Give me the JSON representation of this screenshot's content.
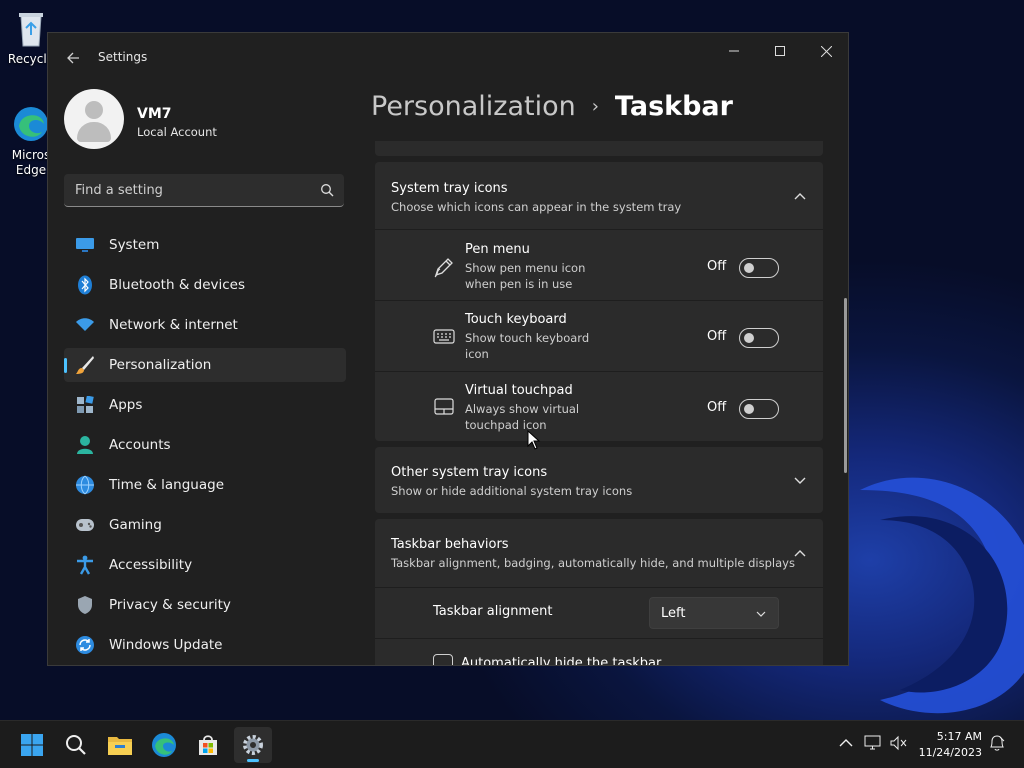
{
  "desktop": {
    "icons": [
      {
        "label": "Recycle",
        "icon": "recycle-bin-icon"
      },
      {
        "label": "Micros Edge",
        "icon": "edge-icon"
      }
    ]
  },
  "window": {
    "title": "Settings",
    "back_icon": "back-arrow-icon",
    "controls": {
      "minimize": "—",
      "maximize": "☐",
      "close": "✕"
    }
  },
  "user": {
    "name": "VM7",
    "account_type": "Local Account"
  },
  "search": {
    "placeholder": "Find a setting",
    "icon": "search-icon"
  },
  "nav": {
    "items": [
      {
        "label": "System",
        "icon": "monitor-icon"
      },
      {
        "label": "Bluetooth & devices",
        "icon": "bluetooth-icon"
      },
      {
        "label": "Network & internet",
        "icon": "wifi-icon"
      },
      {
        "label": "Personalization",
        "icon": "brush-icon",
        "active": true
      },
      {
        "label": "Apps",
        "icon": "apps-icon"
      },
      {
        "label": "Accounts",
        "icon": "person-icon"
      },
      {
        "label": "Time & language",
        "icon": "globe-clock-icon"
      },
      {
        "label": "Gaming",
        "icon": "gamepad-icon"
      },
      {
        "label": "Accessibility",
        "icon": "accessibility-icon"
      },
      {
        "label": "Privacy & security",
        "icon": "shield-icon"
      },
      {
        "label": "Windows Update",
        "icon": "update-icon"
      }
    ]
  },
  "header": {
    "parent": "Personalization",
    "separator": "›",
    "current": "Taskbar"
  },
  "sections": {
    "system_tray": {
      "title": "System tray icons",
      "description": "Choose which icons can appear in the system tray",
      "expanded": true,
      "items": [
        {
          "title": "Pen menu",
          "description": "Show pen menu icon when pen is in use",
          "state": "Off",
          "icon": "pen-icon"
        },
        {
          "title": "Touch keyboard",
          "description": "Show touch keyboard icon",
          "state": "Off",
          "icon": "keyboard-icon"
        },
        {
          "title": "Virtual touchpad",
          "description": "Always show virtual touchpad icon",
          "state": "Off",
          "icon": "touchpad-icon"
        }
      ]
    },
    "other_tray": {
      "title": "Other system tray icons",
      "description": "Show or hide additional system tray icons",
      "expanded": false
    },
    "behaviors": {
      "title": "Taskbar behaviors",
      "description": "Taskbar alignment, badging, automatically hide, and multiple displays",
      "expanded": true,
      "alignment_label": "Taskbar alignment",
      "alignment_value": "Left",
      "auto_hide_label": "Automatically hide the taskbar"
    }
  },
  "taskbar": {
    "apps": [
      "start-icon",
      "search-icon",
      "file-explorer-icon",
      "edge-icon",
      "store-icon",
      "settings-icon"
    ],
    "time": "5:17 AM",
    "date": "11/24/2023"
  },
  "colors": {
    "accent": "#4cc2ff",
    "window_bg": "#202020",
    "card_bg": "#2b2b2b"
  }
}
